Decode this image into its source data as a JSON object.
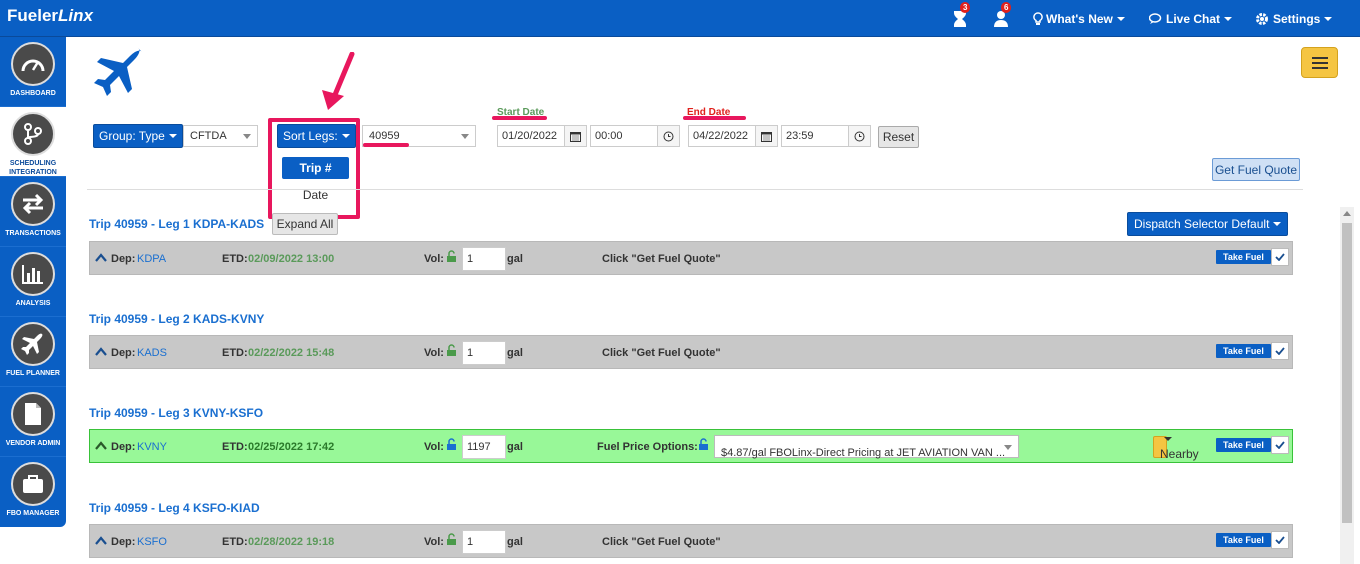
{
  "app": {
    "logo_prefix": "Fueler",
    "logo_suffix": "Linx"
  },
  "topbar": {
    "hourglass_badge": "3",
    "user_badge": "6",
    "whats_new": "What's New",
    "live_chat": "Live Chat",
    "settings": "Settings"
  },
  "sidebar": {
    "items": [
      {
        "label": "DASHBOARD",
        "icon": "dashboard-gauge-icon"
      },
      {
        "label": "SCHEDULING INTEGRATION",
        "icon": "scheduling-integration-icon"
      },
      {
        "label": "TRANSACTIONS",
        "icon": "transactions-arrows-icon"
      },
      {
        "label": "ANALYSIS",
        "icon": "analysis-chart-icon"
      },
      {
        "label": "FUEL PLANNER",
        "icon": "plane-icon"
      },
      {
        "label": "VENDOR ADMIN",
        "icon": "document-icon"
      },
      {
        "label": "FBO MANAGER",
        "icon": "briefcase-icon"
      }
    ]
  },
  "filters": {
    "group_type": "Group: Type",
    "aircraft": "CFTDA",
    "sort_legs": "Sort Legs:",
    "sort_options": [
      "Trip #",
      "Date"
    ],
    "trip_select": "40959",
    "start_date_label": "Start Date",
    "start_date": "01/20/2022",
    "start_time": "00:00",
    "end_date_label": "End Date",
    "end_date": "04/22/2022",
    "end_time": "23:59",
    "reset": "Reset",
    "get_fuel_quote": "Get Fuel Quote",
    "expand_all": "Expand All",
    "dispatch_selector": "Dispatch Selector Default"
  },
  "legs": [
    {
      "title": "Trip 40959 - Leg 1 KDPA-KADS",
      "dep_label": "Dep:",
      "dep": "KDPA",
      "etd_label": "ETD:",
      "etd": "02/09/2022 13:00",
      "vol_label": "Vol:",
      "vol": "1",
      "unit": "gal",
      "message": "Click \"Get Fuel Quote\"",
      "take_fuel": "Take Fuel"
    },
    {
      "title": "Trip 40959 - Leg 2 KADS-KVNY",
      "dep_label": "Dep:",
      "dep": "KADS",
      "etd_label": "ETD:",
      "etd": "02/22/2022 15:48",
      "vol_label": "Vol:",
      "vol": "1",
      "unit": "gal",
      "message": "Click \"Get Fuel Quote\"",
      "take_fuel": "Take Fuel"
    },
    {
      "title": "Trip 40959 - Leg 3 KVNY-KSFO",
      "dep_label": "Dep:",
      "dep": "KVNY",
      "etd_label": "ETD:",
      "etd": "02/25/2022 17:42",
      "vol_label": "Vol:",
      "vol": "1197",
      "unit": "gal",
      "price_label": "Fuel Price Options:",
      "price_option": "$4.87/gal FBOLinx-Direct Pricing at JET AVIATION VAN ...",
      "nearby": "Nearby",
      "take_fuel": "Take Fuel"
    },
    {
      "title": "Trip 40959 - Leg 4 KSFO-KIAD",
      "dep_label": "Dep:",
      "dep": "KSFO",
      "etd_label": "ETD:",
      "etd": "02/28/2022 19:18",
      "vol_label": "Vol:",
      "vol": "1",
      "unit": "gal",
      "message": "Click \"Get Fuel Quote\"",
      "take_fuel": "Take Fuel"
    }
  ],
  "colors": {
    "primary": "#0a5fc4",
    "highlight": "#e8175d",
    "green_row": "#98f898",
    "grey_row": "#c8c8c8"
  }
}
